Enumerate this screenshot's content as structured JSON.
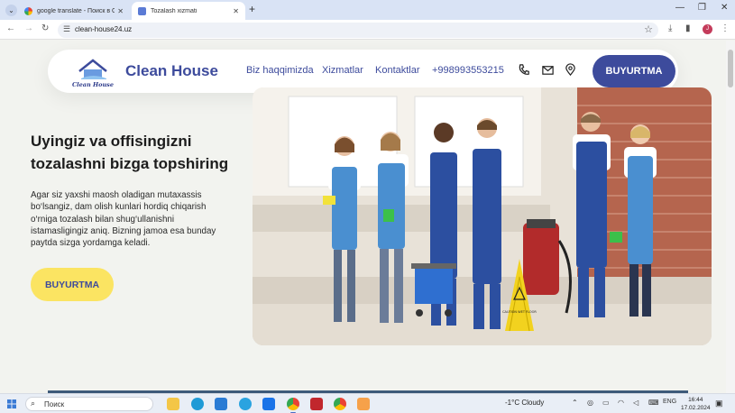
{
  "browser": {
    "tabs": [
      {
        "title": "google translate - Поиск в Google",
        "active": false
      },
      {
        "title": "Tozalash xizmati",
        "active": true
      }
    ],
    "new_tab_symbol": "+",
    "url": "clean-house24.uz",
    "profile_initial": "J"
  },
  "site": {
    "brand_name": "Clean House",
    "logo_text": "Clean House",
    "nav": {
      "about": "Biz haqqimizda",
      "services": "Xizmatlar",
      "contacts": "Kontaktlar",
      "phone": "+998993553215",
      "order_button": "BUYURTMA"
    },
    "hero": {
      "title": "Uyingiz va offisingizni tozalashni bizga topshiring",
      "text": "Agar siz yaxshi maosh oladigan mutaxassis bo‘lsangiz, dam olish kunlari hordiq chiqarish o‘rniga tozalash bilan shug‘ullanishni istamasligingiz aniq. Bizning jamoa esa bunday paytda sizga yordamga keladi.",
      "button": "BUYURTMA",
      "sign_text": "CAUTION WET FLOOR"
    },
    "accent_color": "#3d4b9c",
    "button_yellow": "#fbe462"
  },
  "taskbar": {
    "search_placeholder": "Поиск",
    "weather": "-1°C  Cloudy",
    "language": "ENG",
    "time": "16:44",
    "date": "17.02.2024"
  }
}
